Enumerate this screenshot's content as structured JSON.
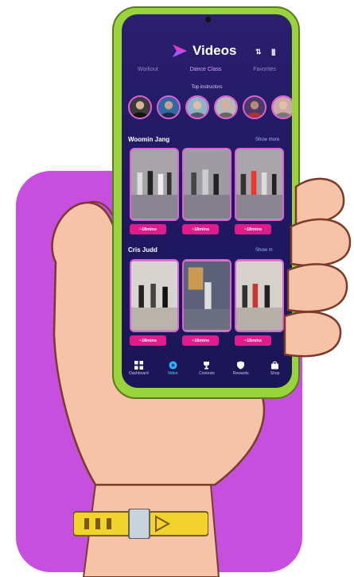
{
  "app": {
    "title": "Videos",
    "header_icons": [
      "sort-icon",
      "filter-icon"
    ],
    "header_icon_text": {
      "sort": "⇅",
      "filter": "|||"
    }
  },
  "tabs": [
    {
      "label": "Workout",
      "active": false
    },
    {
      "label": "Dance Class",
      "active": true
    },
    {
      "label": "Favorites",
      "active": false
    }
  ],
  "top_instructors": {
    "label": "Top instructors",
    "count_visible": 6
  },
  "rows": [
    {
      "title": "Woomin Jang",
      "link": "Show more",
      "videos": [
        {
          "duration": "~18mins"
        },
        {
          "duration": "~18mins"
        },
        {
          "duration": "~18mins"
        }
      ]
    },
    {
      "title": "Cris Judd",
      "link": "Show m",
      "videos": [
        {
          "duration": "~18mins"
        },
        {
          "duration": "~18mins"
        },
        {
          "duration": "~18mins"
        }
      ]
    }
  ],
  "bottom_nav": [
    {
      "label": "Dashboard",
      "icon": "grid-icon",
      "active": false
    },
    {
      "label": "Video",
      "icon": "globe-icon",
      "active": true
    },
    {
      "label": "Contests",
      "icon": "trophy-icon",
      "active": false
    },
    {
      "label": "Rewards",
      "icon": "shield-icon",
      "active": false
    },
    {
      "label": "Shop",
      "icon": "bag-icon",
      "active": false
    }
  ],
  "colors": {
    "background_panel": "#c64fe0",
    "phone_shell": "#9ad43c",
    "screen_bg": "#241a66",
    "accent_pink": "#e21b8d",
    "card_border": "#e061d6",
    "active_tab": "#d6a7ff",
    "active_nav": "#6ed0ff",
    "watch_band": "#f2d22c"
  }
}
